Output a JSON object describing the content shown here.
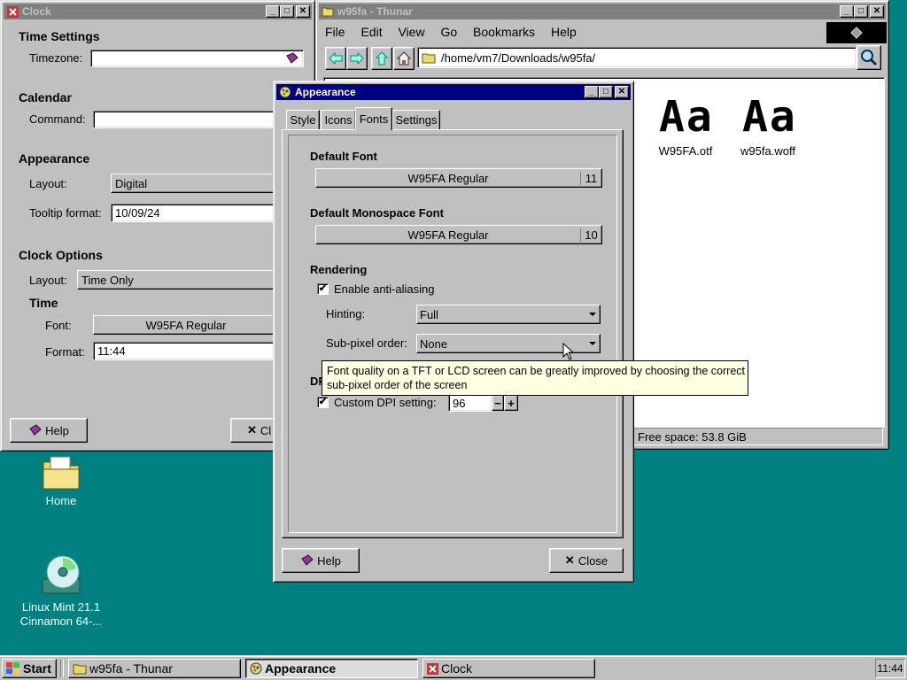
{
  "clock_window": {
    "title": "Clock",
    "sections": {
      "time_settings": "Time Settings",
      "calendar": "Calendar",
      "appearance": "Appearance",
      "clock_options": "Clock Options",
      "time": "Time"
    },
    "timezone_label": "Timezone:",
    "timezone_value": "",
    "command_label": "Command:",
    "command_value": "",
    "layout_label": "Layout:",
    "layout_value": "Digital",
    "tooltip_format_label": "Tooltip format:",
    "tooltip_format_value": "10/09/24",
    "options_layout_label": "Layout:",
    "options_layout_value": "Time Only",
    "font_label": "Font:",
    "font_value": "W95FA Regular",
    "format_label": "Format:",
    "format_value": "11:44",
    "help_label": "Help",
    "close_label": "Cl"
  },
  "thunar_window": {
    "title": "w95fa - Thunar",
    "menu": [
      "File",
      "Edit",
      "View",
      "Go",
      "Bookmarks",
      "Help"
    ],
    "path": "/home/vm7/Downloads/w95fa/",
    "files": [
      {
        "preview": "Aa",
        "name": "W95FA.otf"
      },
      {
        "preview": "Aa",
        "name": "w95fa.woff"
      }
    ],
    "status": "Free space: 53.8 GiB"
  },
  "appearance_dialog": {
    "title": "Appearance",
    "tabs": [
      "Style",
      "Icons",
      "Fonts",
      "Settings"
    ],
    "selected_tab": "Fonts",
    "default_font_header": "Default Font",
    "default_font_name": "W95FA Regular",
    "default_font_size": "11",
    "mono_font_header": "Default Monospace Font",
    "mono_font_name": "W95FA Regular",
    "mono_font_size": "10",
    "rendering_header": "Rendering",
    "antialias_label": "Enable anti-aliasing",
    "antialias_checked": true,
    "hinting_label": "Hinting:",
    "hinting_value": "Full",
    "subpixel_label": "Sub-pixel order:",
    "subpixel_value": "None",
    "dpi_header": "DPI",
    "custom_dpi_label": "Custom DPI setting:",
    "custom_dpi_checked": true,
    "dpi_value": "96",
    "help_label": "Help",
    "close_label": "Close"
  },
  "tooltip": {
    "line1": "Font quality on a TFT or LCD screen can be greatly improved by choosing the correct",
    "line2": "sub-pixel order of the screen"
  },
  "desktop": {
    "icons": [
      {
        "label": "Home"
      },
      {
        "label_line1": "Linux Mint 21.1",
        "label_line2": "Cinnamon 64-..."
      }
    ]
  },
  "taskbar": {
    "start_label": "Start",
    "tasks": [
      {
        "label": "w95fa - Thunar",
        "pressed": false
      },
      {
        "label": "Appearance",
        "pressed": true
      },
      {
        "label": "Clock",
        "pressed": false
      }
    ],
    "clock": "11:44"
  },
  "colors": {
    "desktop": "#008080",
    "active_title": "#000080",
    "inactive_title": "#808080",
    "tooltip_bg": "#ffffe1"
  }
}
